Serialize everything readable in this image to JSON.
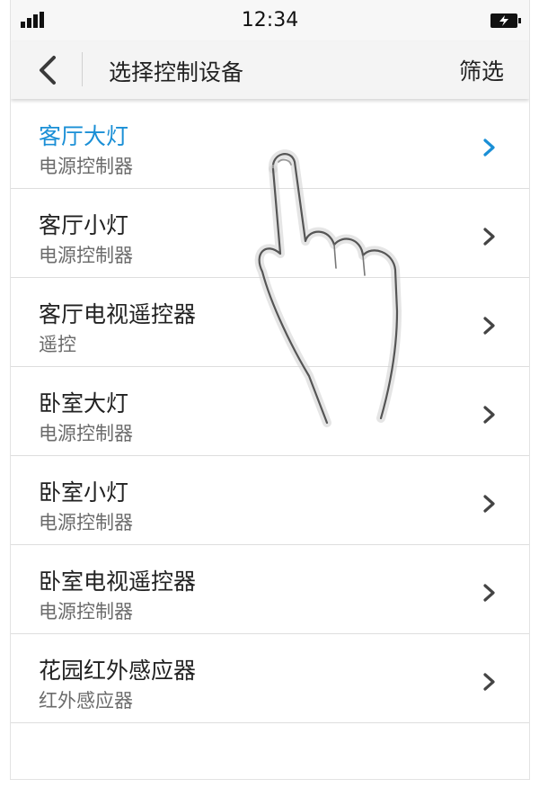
{
  "status_bar": {
    "time": "12:34",
    "signal_icon": "signal-icon",
    "battery_icon": "battery-charging-icon"
  },
  "header": {
    "back_icon": "back-arrow-icon",
    "title": "选择控制设备",
    "filter_label": "筛选"
  },
  "colors": {
    "accent": "#1a8fd6",
    "title_text": "#222222",
    "subtitle_text": "#6b6b6b",
    "divider": "#dedede"
  },
  "items": [
    {
      "title": "客厅大灯",
      "subtitle": "电源控制器",
      "active": true
    },
    {
      "title": "客厅小灯",
      "subtitle": "电源控制器",
      "active": false
    },
    {
      "title": "客厅电视遥控器",
      "subtitle": "遥控",
      "active": false
    },
    {
      "title": "卧室大灯",
      "subtitle": "电源控制器",
      "active": false
    },
    {
      "title": "卧室小灯",
      "subtitle": "电源控制器",
      "active": false
    },
    {
      "title": "卧室电视遥控器",
      "subtitle": "电源控制器",
      "active": false
    },
    {
      "title": "花园红外感应器",
      "subtitle": "红外感应器",
      "active": false
    }
  ],
  "overlay": {
    "gesture_icon": "tap-hand-icon"
  }
}
